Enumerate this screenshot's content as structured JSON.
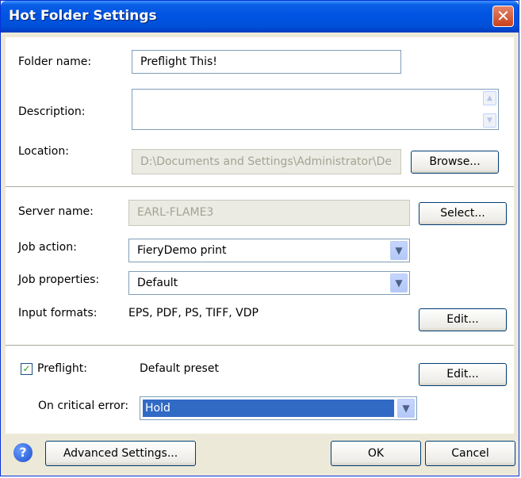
{
  "window": {
    "title": "Hot Folder Settings"
  },
  "folder": {
    "name_label": "Folder name:",
    "name_value": "Preflight This!",
    "description_label": "Description:",
    "description_value": "",
    "location_label": "Location:",
    "location_value": "D:\\Documents and Settings\\Administrator\\De",
    "browse_label": "Browse..."
  },
  "server": {
    "server_label": "Server name:",
    "server_value": "EARL-FLAME3",
    "select_label": "Select...",
    "job_action_label": "Job action:",
    "job_action_value": "FieryDemo print",
    "job_properties_label": "Job properties:",
    "job_properties_value": "Default",
    "input_formats_label": "Input formats:",
    "input_formats_value": "EPS, PDF, PS, TIFF, VDP",
    "edit_label": "Edit..."
  },
  "preflight": {
    "checked": true,
    "label": "Preflight:",
    "preset": "Default preset",
    "edit_label": "Edit...",
    "critical_label": "On critical error:",
    "critical_value": "Hold"
  },
  "footer": {
    "advanced_label": "Advanced Settings...",
    "ok_label": "OK",
    "cancel_label": "Cancel"
  }
}
